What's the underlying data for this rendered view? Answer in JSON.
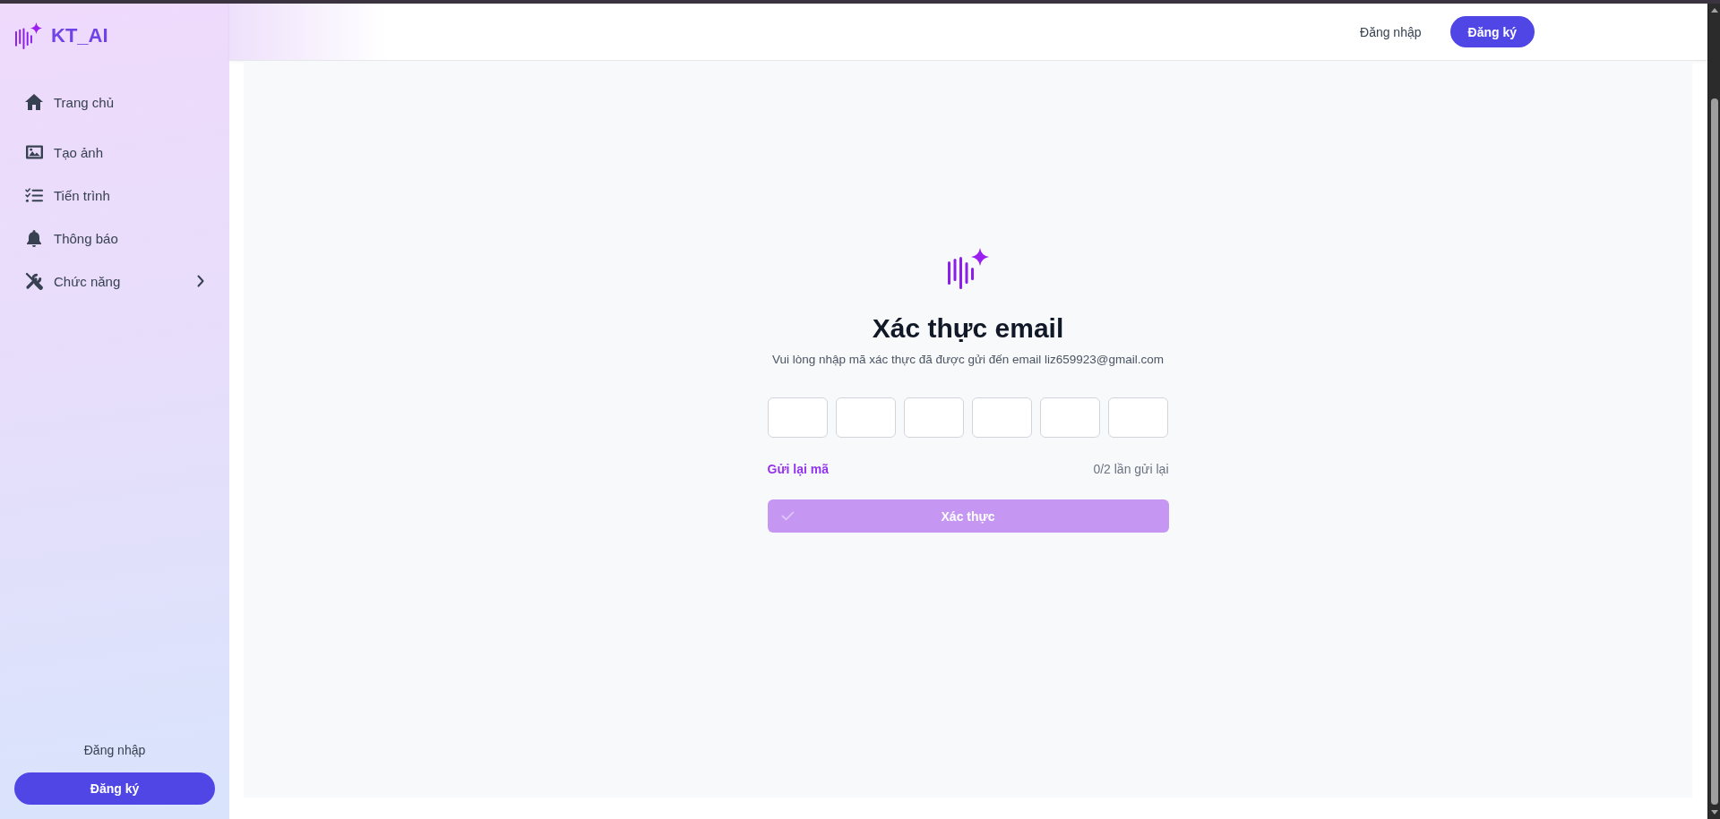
{
  "sidebar": {
    "logo": {
      "text": "KT_AI"
    },
    "items": [
      {
        "label": "Trang chủ",
        "kind": "link",
        "selected": false
      },
      {
        "label": "Tạo ảnh",
        "kind": "link",
        "selected": false
      },
      {
        "label": "Tiến trình",
        "kind": "link",
        "selected": false
      },
      {
        "label": "Thông báo",
        "kind": "link",
        "selected": false
      },
      {
        "label": "Chức năng",
        "kind": "submenu",
        "expanded": false,
        "selected": false
      }
    ],
    "login_link": "Đăng nhập",
    "register_button": "Đăng ký"
  },
  "top_bar": {
    "login_link": "Đăng nhập",
    "register_button": "Đăng ký"
  },
  "email_verification": {
    "title": "Xác thực email",
    "subtitle": "Vui lòng nhập mã xác thực đã được gửi đến email liz659923@gmail.com",
    "code_fields": [
      {
        "focused": false
      },
      {
        "focused": false
      },
      {
        "focused": false
      },
      {
        "focused": false
      },
      {
        "focused": false
      },
      {
        "focused": false
      }
    ],
    "resend_link": "Gửi lại mã",
    "resend_count": "0/2 lần gửi lại",
    "verify_button": {
      "label": "Xác thực",
      "disabled": true
    }
  }
}
